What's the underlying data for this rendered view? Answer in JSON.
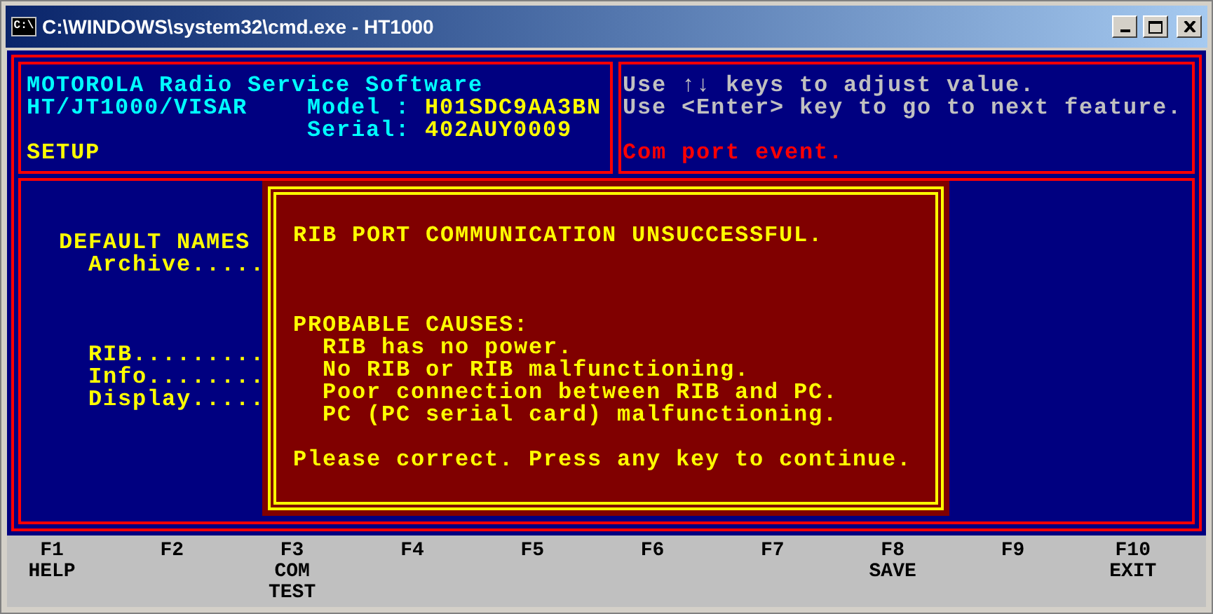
{
  "window": {
    "title": "C:\\WINDOWS\\system32\\cmd.exe - HT1000",
    "icon_text": "C:\\"
  },
  "header": {
    "product": "MOTOROLA Radio Service Software",
    "variant": "HT/JT1000/VISAR",
    "model_label": "Model :",
    "model": "H01SDC9AA3BN",
    "serial_label": "Serial:",
    "serial": "402AUY0009",
    "mode": "SETUP"
  },
  "help": {
    "lines": [
      "Use ↑↓ keys to adjust value.",
      "Use <Enter> key to go to next feature."
    ],
    "status": "Com port event."
  },
  "main": {
    "section_title": "DEFAULT NAMES",
    "archive_fields": [
      "Archive....."
    ],
    "device_fields": [
      "RIB.........",
      "Info........",
      "Display....."
    ]
  },
  "dialog": {
    "title": "RIB PORT COMMUNICATION UNSUCCESSFUL.",
    "causes_heading": "PROBABLE CAUSES:",
    "causes": [
      "RIB has no power.",
      "No RIB or RIB malfunctioning.",
      "Poor connection between RIB and PC.",
      "PC (PC serial card) malfunctioning."
    ],
    "footer": "Please correct. Press any key to continue."
  },
  "function_keys": [
    {
      "key": "F1",
      "label": [
        "HELP"
      ]
    },
    {
      "key": "F2"
    },
    {
      "key": "F3",
      "label": [
        "COM",
        "TEST"
      ]
    },
    {
      "key": "F4"
    },
    {
      "key": "F5"
    },
    {
      "key": "F6"
    },
    {
      "key": "F7"
    },
    {
      "key": "F8",
      "label": [
        "SAVE"
      ]
    },
    {
      "key": "F9"
    },
    {
      "key": "F10",
      "label": [
        "EXIT"
      ]
    }
  ]
}
